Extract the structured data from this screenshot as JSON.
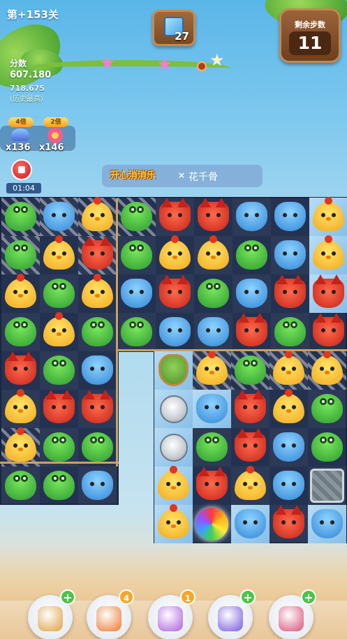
{
  "level": {
    "label": "第+153关"
  },
  "score": {
    "label": "分数",
    "value": "607.180",
    "history_value": "718.675",
    "history_label": "(历史最高)"
  },
  "target": {
    "count": "27"
  },
  "moves": {
    "label": "剩余步数",
    "value": "11"
  },
  "boosts": [
    {
      "badge": "4倍",
      "count": "x136",
      "icon": "bird-stack-icon"
    },
    {
      "badge": "2倍",
      "count": "x146",
      "icon": "flower-icon"
    }
  ],
  "timer": {
    "value": "01:04"
  },
  "collab": {
    "logo": "开心消消乐",
    "x": "×",
    "name": "花千骨"
  },
  "board": {
    "colors": {
      "frog": "#3ab03a",
      "hippo": "#4a9be0",
      "chick": "#f6c02a",
      "fox": "#d83a2a"
    },
    "left_grid": [
      [
        "frog",
        "hippo",
        "chick"
      ],
      [
        "frog",
        "chick",
        "fox"
      ],
      [
        "chick",
        "frog",
        "chick"
      ],
      [
        "frog",
        "chick",
        "frog"
      ],
      [
        "fox",
        "frog",
        "hippo"
      ],
      [
        "chick",
        "fox",
        "fox"
      ],
      [
        "chick",
        "frog",
        "frog"
      ],
      [
        "frog",
        "frog",
        "hippo"
      ]
    ],
    "top_right_grid": [
      [
        "frog",
        "fox",
        "fox",
        "hippo",
        "hippo",
        "chick"
      ],
      [
        "frog",
        "chick",
        "chick",
        "frog",
        "hippo",
        "chick"
      ],
      [
        "hippo",
        "fox",
        "frog",
        "hippo",
        "fox",
        "fox"
      ],
      [
        "frog",
        "hippo",
        "hippo",
        "fox",
        "frog",
        "fox"
      ]
    ],
    "bottom_right_grid": [
      [
        "shield",
        "chick",
        "frog",
        "chick",
        "chick"
      ],
      [
        "coin",
        "hippo",
        "fox",
        "chick",
        "frog"
      ],
      [
        "coin",
        "frog",
        "fox",
        "hippo",
        "frog"
      ],
      [
        "chick",
        "fox",
        "chick",
        "hippo",
        "stone"
      ],
      [
        "chick",
        "rainbow",
        "hippo",
        "fox",
        "hippo"
      ]
    ]
  },
  "tools": [
    {
      "name": "shuffle-tool",
      "badge": "+",
      "icon": "shuffle-icon"
    },
    {
      "name": "undo-tool",
      "badge": "4",
      "icon": "clock-icon"
    },
    {
      "name": "swap-tool",
      "badge": "1",
      "icon": "swap-icon"
    },
    {
      "name": "line-effect-tool",
      "badge": "+",
      "icon": "line-effect-icon"
    },
    {
      "name": "hammer-tool",
      "badge": "+",
      "icon": "hammer-icon"
    }
  ]
}
